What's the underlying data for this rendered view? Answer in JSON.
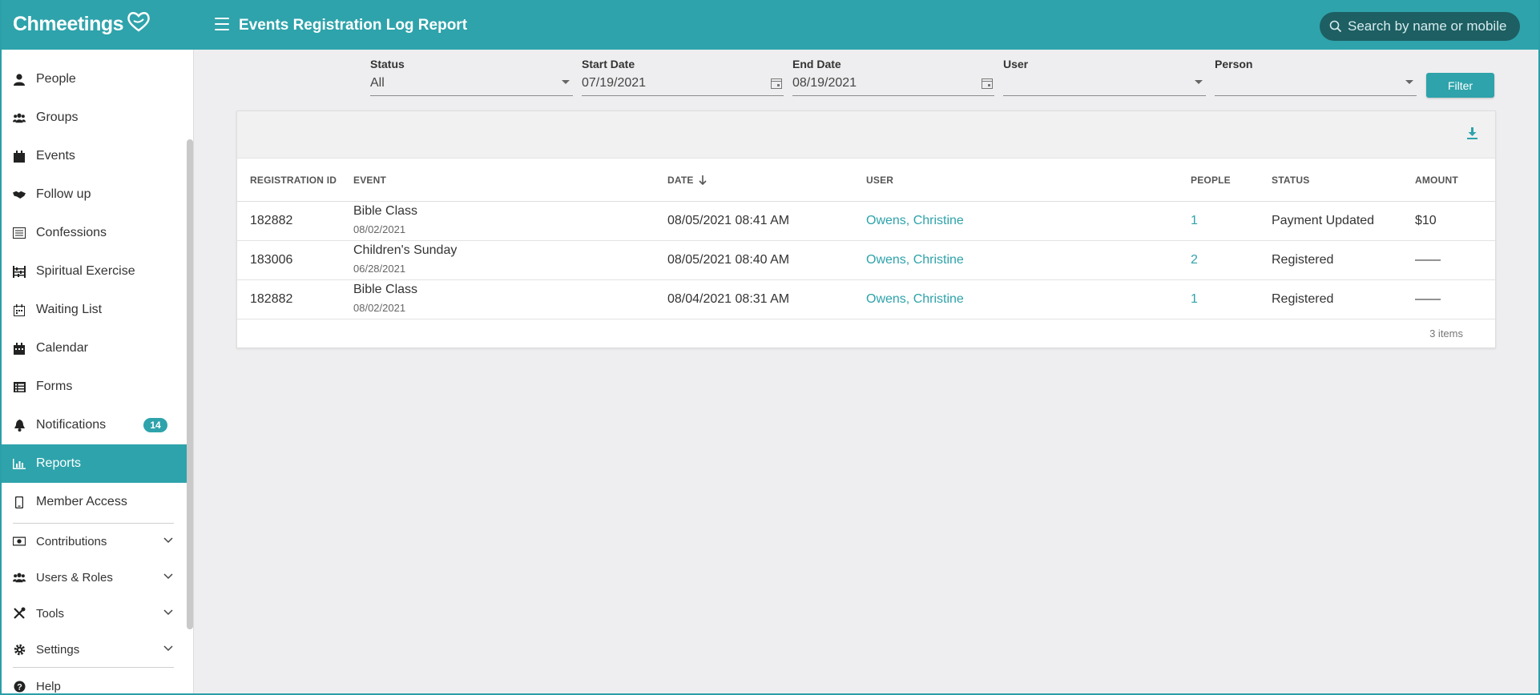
{
  "app": {
    "logo_text": "Chmeetings",
    "page_title": "Events Registration Log Report",
    "search_placeholder": "Search by name or mobile"
  },
  "sidebar": {
    "items": [
      {
        "label": "People",
        "icon": "person-icon"
      },
      {
        "label": "Groups",
        "icon": "users-icon"
      },
      {
        "label": "Events",
        "icon": "calendar-icon"
      },
      {
        "label": "Follow up",
        "icon": "handshake-icon"
      },
      {
        "label": "Confessions",
        "icon": "list-icon"
      },
      {
        "label": "Spiritual Exercise",
        "icon": "abacus-icon"
      },
      {
        "label": "Waiting List",
        "icon": "calendar-list-icon"
      },
      {
        "label": "Calendar",
        "icon": "calendar-icon"
      },
      {
        "label": "Forms",
        "icon": "form-icon"
      },
      {
        "label": "Notifications",
        "icon": "bell-icon",
        "badge": "14"
      },
      {
        "label": "Reports",
        "icon": "chart-icon",
        "active": true
      },
      {
        "label": "Member Access",
        "icon": "mobile-icon"
      },
      {
        "label": "Contributions",
        "icon": "money-icon",
        "expandable": true
      },
      {
        "label": "Users & Roles",
        "icon": "users-icon",
        "expandable": true
      },
      {
        "label": "Tools",
        "icon": "tools-icon",
        "expandable": true
      },
      {
        "label": "Settings",
        "icon": "gear-icon",
        "expandable": true
      },
      {
        "label": "Help",
        "icon": "question-icon"
      }
    ]
  },
  "filters": {
    "status": {
      "label": "Status",
      "value": "All"
    },
    "start_date": {
      "label": "Start Date",
      "value": "07/19/2021"
    },
    "end_date": {
      "label": "End Date",
      "value": "08/19/2021"
    },
    "user": {
      "label": "User",
      "value": ""
    },
    "person": {
      "label": "Person",
      "value": ""
    },
    "button_label": "Filter"
  },
  "table": {
    "columns": [
      "REGISTRATION ID",
      "EVENT",
      "DATE",
      "USER",
      "PEOPLE",
      "STATUS",
      "AMOUNT"
    ],
    "rows": [
      {
        "id": "182882",
        "event": "Bible Class",
        "event_date": "08/02/2021",
        "date": "08/05/2021 08:41 AM",
        "user": "Owens, Christine",
        "people": "1",
        "status": "Payment Updated",
        "amount": "$10"
      },
      {
        "id": "183006",
        "event": "Children's Sunday",
        "event_date": "06/28/2021",
        "date": "08/05/2021 08:40 AM",
        "user": "Owens, Christine",
        "people": "2",
        "status": "Registered",
        "amount": "——"
      },
      {
        "id": "182882",
        "event": "Bible Class",
        "event_date": "08/02/2021",
        "date": "08/04/2021 08:31 AM",
        "user": "Owens, Christine",
        "people": "1",
        "status": "Registered",
        "amount": "——"
      }
    ],
    "items_count": "3 items"
  },
  "colors": {
    "accent": "#2ea3ab",
    "search_bg": "#1d5f63"
  }
}
